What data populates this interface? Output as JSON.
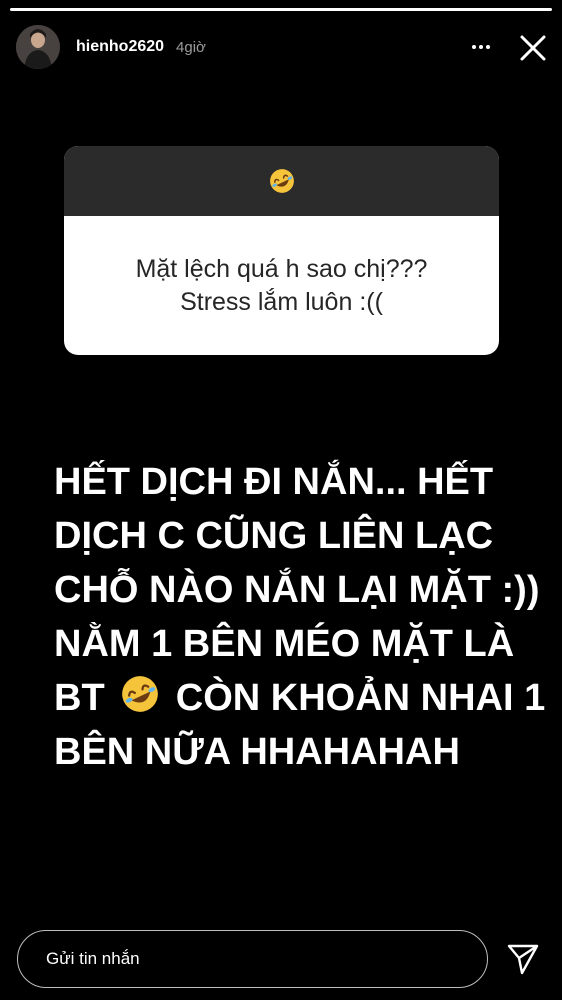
{
  "story": {
    "progress": 1.0,
    "username": "hienho2620",
    "timestamp": "4giờ",
    "icons": {
      "more": "more-horizontal-icon",
      "close": "close-icon",
      "send": "send-icon",
      "avatar": "profile-photo"
    }
  },
  "question_card": {
    "emoji": "rolling-on-floor-laughing-emoji",
    "lines": [
      "Mặt lệch quá h sao chị???",
      "Stress lắm luôn :(("
    ]
  },
  "answer": {
    "line1": "HẾT DỊCH ĐI NẮN... HẾT",
    "line2": "DỊCH C CŨNG LIÊN LẠC",
    "line3": "CHỖ NÀO NẮN LẠI MẶT :))",
    "line4": "NẰM 1 BÊN MÉO MẶT LÀ",
    "line5_before": "BT",
    "line5_emoji": "rolling-on-floor-laughing-emoji",
    "line5_after": "CÒN KHOẢN NHAI 1",
    "line6": "BÊN NỮA HHAHAHAH"
  },
  "reply": {
    "placeholder": "Gửi tin nhắn"
  },
  "colors": {
    "background": "#000000",
    "card_top": "#2b2b2b",
    "card_body": "#ffffff",
    "card_text": "#262626",
    "emoji_face": "#f6c43b"
  }
}
